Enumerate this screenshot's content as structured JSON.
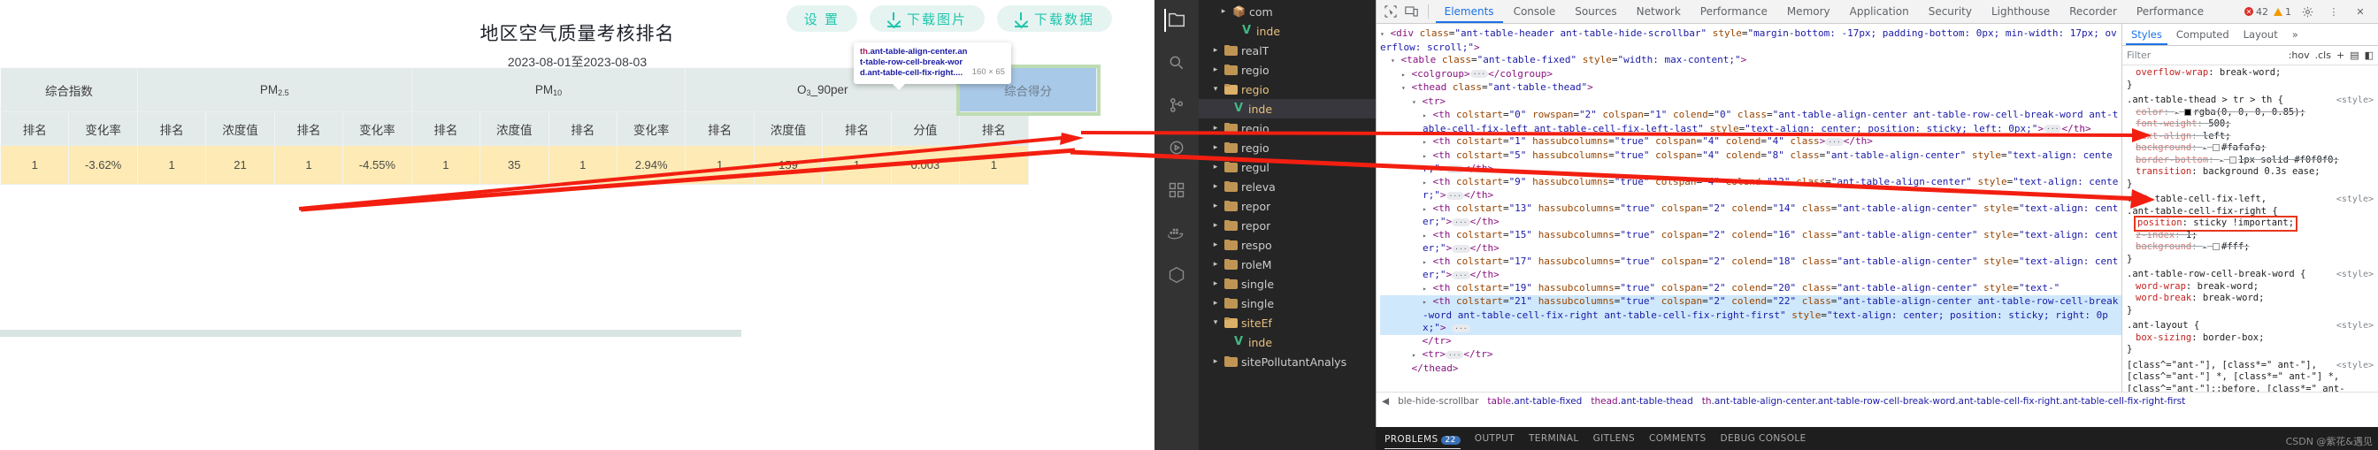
{
  "webapp": {
    "toolbar": {
      "settings_label": "设 置",
      "download_image_label": "下载图片",
      "download_data_label": "下载数据"
    },
    "chart": {
      "title": "地区空气质量考核排名",
      "subtitle": "2023-08-01至2023-08-03"
    },
    "inspector_tooltip": {
      "tag": "th",
      "selector": ".ant-table-align-center.ant-table-row-cell-break-word.ant-table-cell-fix-right....",
      "size": "160 × 65"
    },
    "table": {
      "group_headers": [
        {
          "label": "综合指数",
          "colspan": 2
        },
        {
          "label": "PM",
          "sub": "2.5",
          "colspan": 4
        },
        {
          "label": "PM",
          "sub": "10",
          "colspan": 4
        },
        {
          "label": "O",
          "sub": "3",
          "suffix": "_90per",
          "colspan": 4
        },
        {
          "label": "综合得分",
          "colspan": 2,
          "highlighted": true
        }
      ],
      "sub_headers": [
        "排名",
        "变化率",
        "排名",
        "浓度值",
        "排名",
        "变化率",
        "排名",
        "浓度值",
        "排名",
        "变化率",
        "排名",
        "浓度值",
        "排名",
        "分值",
        "排名"
      ],
      "rows": [
        [
          "1",
          "-3.62%",
          "1",
          "21",
          "1",
          "-4.55%",
          "1",
          "35",
          "1",
          "2.94%",
          "1",
          "159",
          "1",
          "0.003",
          "1"
        ]
      ]
    }
  },
  "vscode": {
    "activity_icons": [
      "explorer-icon",
      "search-icon",
      "source-control-icon",
      "run-debug-icon",
      "extensions-icon",
      "docker-icon",
      "remote-icon"
    ],
    "explorer_items": [
      {
        "name": "com",
        "type": "package",
        "arrow": "▸",
        "indent": 2
      },
      {
        "name": "inde",
        "type": "vue",
        "arrow": "",
        "indent": 3
      },
      {
        "name": "realT",
        "type": "folder",
        "arrow": "▸",
        "indent": 1
      },
      {
        "name": "regio",
        "type": "folder",
        "arrow": "▸",
        "indent": 1
      },
      {
        "name": "regio",
        "type": "folder-open",
        "arrow": "▾",
        "indent": 1
      },
      {
        "name": "inde",
        "type": "vue",
        "arrow": "",
        "indent": 2,
        "selected": true
      },
      {
        "name": "regio",
        "type": "folder",
        "arrow": "▸",
        "indent": 1
      },
      {
        "name": "regio",
        "type": "folder",
        "arrow": "▸",
        "indent": 1
      },
      {
        "name": "regul",
        "type": "folder",
        "arrow": "▸",
        "indent": 1
      },
      {
        "name": "releva",
        "type": "folder",
        "arrow": "▸",
        "indent": 1
      },
      {
        "name": "repor",
        "type": "folder",
        "arrow": "▸",
        "indent": 1
      },
      {
        "name": "repor",
        "type": "folder",
        "arrow": "▸",
        "indent": 1
      },
      {
        "name": "respo",
        "type": "folder",
        "arrow": "▸",
        "indent": 1
      },
      {
        "name": "roleM",
        "type": "folder",
        "arrow": "▸",
        "indent": 1
      },
      {
        "name": "single",
        "type": "folder",
        "arrow": "▸",
        "indent": 1
      },
      {
        "name": "single",
        "type": "folder",
        "arrow": "▸",
        "indent": 1
      },
      {
        "name": "siteEf",
        "type": "folder-open",
        "arrow": "▾",
        "indent": 1
      },
      {
        "name": "inde",
        "type": "vue",
        "arrow": "",
        "indent": 2
      },
      {
        "name": "sitePollutantAnalys",
        "type": "folder",
        "arrow": "▸",
        "indent": 1
      }
    ],
    "panel_tabs": [
      {
        "label": "PROBLEMS",
        "badge": "22",
        "active": true
      },
      {
        "label": "OUTPUT",
        "badge": ""
      },
      {
        "label": "TERMINAL",
        "badge": ""
      },
      {
        "label": "GITLENS",
        "badge": ""
      },
      {
        "label": "COMMENTS",
        "badge": ""
      },
      {
        "label": "DEBUG CONSOLE",
        "badge": ""
      }
    ]
  },
  "devtools": {
    "tabs": [
      "Elements",
      "Console",
      "Sources",
      "Network",
      "Performance",
      "Memory",
      "Application",
      "Security",
      "Lighthouse",
      "Recorder",
      "Performance insights"
    ],
    "active_tab": "Elements",
    "error_count": "42",
    "warn_count": "1",
    "dom_lines": [
      {
        "indent": 0,
        "tri": "▾",
        "html": "<span class=\"tg\">&lt;div</span> <span class=\"at\">class</span>=<span class=\"av\">\"ant-table-header ant-table-hide-scrollbar\"</span> <span class=\"at\">style</span>=<span class=\"av\">\"margin-bottom: -17px; padding-bottom: 0px; min-width: 17px; overflow: scroll;\"</span><span class=\"tg\">&gt;</span>"
      },
      {
        "indent": 1,
        "tri": "▾",
        "html": "<span class=\"tg\">&lt;table</span> <span class=\"at\">class</span>=<span class=\"av\">\"ant-table-fixed\"</span> <span class=\"at\">style</span>=<span class=\"av\">\"width: max-content;\"</span><span class=\"tg\">&gt;</span>"
      },
      {
        "indent": 2,
        "tri": "▸",
        "html": "<span class=\"tg\">&lt;colgroup&gt;</span><span class=\"ellipsis\">···</span><span class=\"tg\">&lt;/colgroup&gt;</span>"
      },
      {
        "indent": 2,
        "tri": "▾",
        "html": "<span class=\"tg\">&lt;thead</span> <span class=\"at\">class</span>=<span class=\"av\">\"ant-table-thead\"</span><span class=\"tg\">&gt;</span>"
      },
      {
        "indent": 3,
        "tri": "▾",
        "html": "<span class=\"tg\">&lt;tr&gt;</span>"
      },
      {
        "indent": 4,
        "tri": "▸",
        "html": "<span class=\"tg\">&lt;th</span> <span class=\"at\">colstart</span>=<span class=\"av\">\"0\"</span> <span class=\"at\">rowspan</span>=<span class=\"av\">\"2\"</span> <span class=\"at\">colspan</span>=<span class=\"av\">\"1\"</span> <span class=\"at\">colend</span>=<span class=\"av\">\"0\"</span> <span class=\"at\">class</span>=<span class=\"av\">\"ant-table-align-center ant-table-row-cell-break-word ant-table-cell-fix-left ant-table-cell-fix-left-last\"</span> <span class=\"at\">style</span>=<span class=\"av\">\"text-align: center; position: sticky; left: 0px;\"</span><span class=\"tg\">&gt;</span><span class=\"ellipsis\">···</span><span class=\"tg\">&lt;/th&gt;</span>"
      },
      {
        "indent": 4,
        "tri": "▸",
        "html": "<span class=\"tg\">&lt;th</span> <span class=\"at\">colstart</span>=<span class=\"av\">\"1\"</span> <span class=\"at\">hassubcolumns</span>=<span class=\"av\">\"true\"</span> <span class=\"at\">colspan</span>=<span class=\"av\">\"4\"</span> <span class=\"at\">colend</span>=<span class=\"av\">\"4\"</span> <span class=\"at\">class</span><span class=\"tg\">&gt;</span><span class=\"ellipsis\">···</span><span class=\"tg\">&lt;/th&gt;</span>"
      },
      {
        "indent": 4,
        "tri": "▸",
        "html": "<span class=\"tg\">&lt;th</span> <span class=\"at\">colstart</span>=<span class=\"av\">\"5\"</span> <span class=\"at\">hassubcolumns</span>=<span class=\"av\">\"true\"</span> <span class=\"at\">colspan</span>=<span class=\"av\">\"4\"</span> <span class=\"at\">colend</span>=<span class=\"av\">\"8\"</span> <span class=\"at\">class</span>=<span class=\"av\">\"ant-table-align-center\"</span> <span class=\"at\">style</span>=<span class=\"av\">\"text-align: center;\"</span><span class=\"tg\">&gt;</span><span class=\"ellipsis\">···</span><span class=\"tg\">&lt;/th&gt;</span>"
      },
      {
        "indent": 4,
        "tri": "▸",
        "html": "<span class=\"tg\">&lt;th</span> <span class=\"at\">colstart</span>=<span class=\"av\">\"9\"</span> <span class=\"at\">hassubcolumns</span>=<span class=\"av\">\"true\"</span> <span class=\"at\">colspan</span>=<span class=\"av\">\"4\"</span> <span class=\"at\">colend</span>=<span class=\"av\">\"12\"</span> <span class=\"at\">class</span>=<span class=\"av\">\"ant-table-align-center\"</span> <span class=\"at\">style</span>=<span class=\"av\">\"text-align: center;\"</span><span class=\"tg\">&gt;</span><span class=\"ellipsis\">···</span><span class=\"tg\">&lt;/th&gt;</span>"
      },
      {
        "indent": 4,
        "tri": "▸",
        "html": "<span class=\"tg\">&lt;th</span> <span class=\"at\">colstart</span>=<span class=\"av\">\"13\"</span> <span class=\"at\">hassubcolumns</span>=<span class=\"av\">\"true\"</span> <span class=\"at\">colspan</span>=<span class=\"av\">\"2\"</span> <span class=\"at\">colend</span>=<span class=\"av\">\"14\"</span> <span class=\"at\">class</span>=<span class=\"av\">\"ant-table-align-center\"</span> <span class=\"at\">style</span>=<span class=\"av\">\"text-align: center;\"</span><span class=\"tg\">&gt;</span><span class=\"ellipsis\">···</span><span class=\"tg\">&lt;/th&gt;</span>"
      },
      {
        "indent": 4,
        "tri": "▸",
        "html": "<span class=\"tg\">&lt;th</span> <span class=\"at\">colstart</span>=<span class=\"av\">\"15\"</span> <span class=\"at\">hassubcolumns</span>=<span class=\"av\">\"true\"</span> <span class=\"at\">colspan</span>=<span class=\"av\">\"2\"</span> <span class=\"at\">colend</span>=<span class=\"av\">\"16\"</span> <span class=\"at\">class</span>=<span class=\"av\">\"ant-table-align-center\"</span> <span class=\"at\">style</span>=<span class=\"av\">\"text-align: center;\"</span><span class=\"tg\">&gt;</span><span class=\"ellipsis\">···</span><span class=\"tg\">&lt;/th&gt;</span>"
      },
      {
        "indent": 4,
        "tri": "▸",
        "html": "<span class=\"tg\">&lt;th</span> <span class=\"at\">colstart</span>=<span class=\"av\">\"17\"</span> <span class=\"at\">hassubcolumns</span>=<span class=\"av\">\"true\"</span> <span class=\"at\">colspan</span>=<span class=\"av\">\"2\"</span> <span class=\"at\">colend</span>=<span class=\"av\">\"18\"</span> <span class=\"at\">class</span>=<span class=\"av\">\"ant-table-align-center\"</span> <span class=\"at\">style</span>=<span class=\"av\">\"text-align: center;\"</span><span class=\"tg\">&gt;</span><span class=\"ellipsis\">···</span><span class=\"tg\">&lt;/th&gt;</span>"
      },
      {
        "indent": 4,
        "tri": "▸",
        "html": "<span class=\"tg\">&lt;th</span> <span class=\"at\">colstart</span>=<span class=\"av\">\"19\"</span> <span class=\"at\">hassubcolumns</span>=<span class=\"av\">\"true\"</span> <span class=\"at\">colspan</span>=<span class=\"av\">\"2\"</span> <span class=\"at\">colend</span>=<span class=\"av\">\"20\"</span> <span class=\"at\">class</span>=<span class=\"av\">\"ant-table-align-center\"</span> <span class=\"at\">style</span>=<span class=\"av\">\"text-\"</span>"
      },
      {
        "indent": 4,
        "tri": "▸",
        "selected": true,
        "html": "<span class=\"tg\">&lt;th</span> <span class=\"at\">colstart</span>=<span class=\"av\">\"21\"</span> <span class=\"at\">hassubcolumns</span>=<span class=\"av\">\"true\"</span> <span class=\"at\">colspan</span>=<span class=\"av\">\"2\"</span> <span class=\"at\">colend</span>=<span class=\"av\">\"22\"</span> <span class=\"at\">class</span>=<span class=\"av\">\"ant-table-align-center ant-table-row-cell-break-word ant-table-cell-fix-right ant-table-cell-fix-right-first\"</span> <span class=\"at\">style</span>=<span class=\"av\">\"text-align: center; position: sticky; right: 0px;\"</span><span class=\"tg\">&gt;</span> <span class=\"ellipsis\">···</span>"
      },
      {
        "indent": 3,
        "tri": "",
        "html": "<span class=\"tg\">&lt;/tr&gt;</span>"
      },
      {
        "indent": 3,
        "tri": "▸",
        "html": "<span class=\"tg\">&lt;tr&gt;</span><span class=\"ellipsis\">···</span><span class=\"tg\">&lt;/tr&gt;</span>"
      },
      {
        "indent": 2,
        "tri": "",
        "html": "<span class=\"tg\">&lt;/thead&gt;</span>"
      }
    ],
    "breadcrumb": [
      {
        "text": "ble-hide-scrollbar",
        "cls": ""
      },
      {
        "text": "table",
        "cls": "sel",
        "sub": ".ant-table-fixed"
      },
      {
        "text": "thead",
        "cls": "sel",
        "sub": ".ant-table-thead"
      },
      {
        "text": "th",
        "cls": "sel",
        "sub": ".ant-table-align-center.ant-table-row-cell-break-word.ant-table-cell-fix-right.ant-table-cell-fix-right-first"
      }
    ],
    "styles": {
      "tabs": [
        "Styles",
        "Computed",
        "Layout",
        "»"
      ],
      "active_tab": "Styles",
      "filter_placeholder": "Filter",
      "controls": [
        ":hov",
        ".cls",
        "+",
        "▤",
        "◧"
      ],
      "rules": [
        {
          "selector": "",
          "origin": "",
          "declarations": [
            {
              "prop": "overflow-wrap",
              "value": "break-word;",
              "struck": false
            },
            {
              "prop": "}",
              "value": "",
              "raw": true
            }
          ]
        },
        {
          "selector": ".ant-table-thead > tr > th {",
          "origin": "<style>",
          "declarations": [
            {
              "prop": "color",
              "value": "rgba(0, 0, 0, 0.85);",
              "struck": true,
              "swatch": "#000000"
            },
            {
              "prop": "font-weight",
              "value": "500;",
              "struck": true
            },
            {
              "prop": "text-align",
              "value": "left;",
              "struck": true
            },
            {
              "prop": "background",
              "value": "#fafafa;",
              "struck": true,
              "swatch": "#fafafa"
            },
            {
              "prop": "border-bottom",
              "value": "1px solid #f0f0f0;",
              "struck": true,
              "swatch": "#f0f0f0"
            },
            {
              "prop": "transition",
              "value": "background 0.3s ease;",
              "struck": false
            }
          ]
        },
        {
          "selector": ".ant-table-cell-fix-left,\n.ant-table-cell-fix-right {",
          "origin": "<style>",
          "declarations": [
            {
              "prop": "position",
              "value": "sticky !important;",
              "struck": false,
              "highlight": true
            },
            {
              "prop": "z-index",
              "value": "1;",
              "struck": true
            },
            {
              "prop": "background",
              "value": "#fff;",
              "struck": true,
              "swatch": "#ffffff"
            }
          ]
        },
        {
          "selector": ".ant-table-row-cell-break-word {",
          "origin": "<style>",
          "declarations": [
            {
              "prop": "word-wrap",
              "value": "break-word;",
              "struck": false
            },
            {
              "prop": "word-break",
              "value": "break-word;",
              "struck": false
            }
          ]
        },
        {
          "selector": ".ant-layout {",
          "origin": "<style>",
          "declarations": [
            {
              "prop": "box-sizing",
              "value": "border-box;",
              "struck": false
            }
          ]
        },
        {
          "selector": "[class^=\"ant-\"], [class*=\" ant-\"],\n[class^=\"ant-\"] *, [class*=\" ant-\"] *,\n[class^=\"ant-\"]::before, [class*=\" ant-\"]::before,\n[class^=\"ant-\"]::after, [class*=\" ant-\"]::after {",
          "origin": "<style>",
          "declarations": []
        }
      ]
    }
  },
  "watermark": "CSDN @紫花&遇见"
}
